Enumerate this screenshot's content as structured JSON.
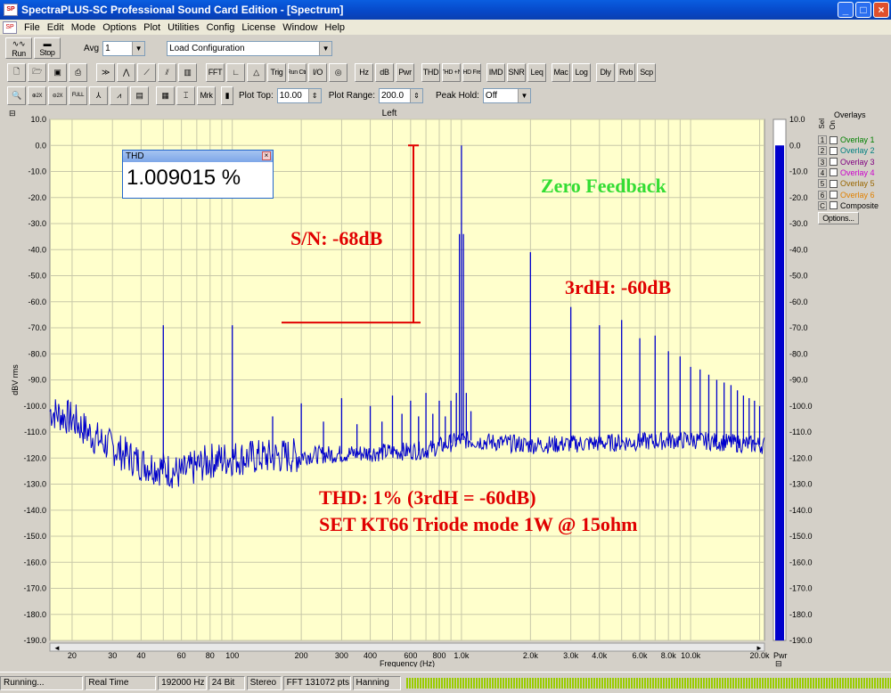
{
  "window": {
    "title": "SpectraPLUS-SC Professional Sound Card Edition - [Spectrum]",
    "buttons": [
      "_",
      "□",
      "×"
    ]
  },
  "menu": [
    "File",
    "Edit",
    "Mode",
    "Options",
    "Plot",
    "Utilities",
    "Config",
    "License",
    "Window",
    "Help"
  ],
  "toolbar1": {
    "run_label": "Run",
    "stop_label": "Stop",
    "avg_label": "Avg",
    "avg_value": "1",
    "config_value": "Load Configuration"
  },
  "toolbar2": [
    "FFT",
    "Trig",
    "Run Ctrl",
    "I/O",
    "Hz",
    "dB",
    "Pwr",
    "THD",
    "THD +N",
    "THD Freq",
    "IMD",
    "SNR",
    "Leq",
    "Mac",
    "Log",
    "Dly",
    "Rvb",
    "Scp"
  ],
  "toolbar3": {
    "plot_top_label": "Plot Top:",
    "plot_top_value": "10.00",
    "plot_range_label": "Plot Range:",
    "plot_range_value": "200.0",
    "peak_hold_label": "Peak Hold:",
    "peak_hold_value": "Off",
    "marker_label": "Mrk"
  },
  "plot": {
    "channel_title": "Left",
    "ylabel": "dBV rms",
    "xlabel": "Frequency (Hz)",
    "y_ticks": [
      "10.0",
      "0.0",
      "-10.0",
      "-20.0",
      "-30.0",
      "-40.0",
      "-50.0",
      "-60.0",
      "-70.0",
      "-80.0",
      "-90.0",
      "-100.0",
      "-110.0",
      "-120.0",
      "-130.0",
      "-140.0",
      "-150.0",
      "-160.0",
      "-170.0",
      "-180.0",
      "-190.0"
    ],
    "x_ticks": [
      "20",
      "30",
      "40",
      "60",
      "80",
      "100",
      "200",
      "300",
      "400",
      "600",
      "800",
      "1.0k",
      "2.0k",
      "3.0k",
      "4.0k",
      "6.0k",
      "8.0k",
      "10.0k",
      "20.0k"
    ],
    "line_color": "#0000cc",
    "background": "#ffffcc"
  },
  "chart_data": {
    "type": "line",
    "xscale": "log",
    "xlim": [
      16,
      21000
    ],
    "ylim": [
      -190,
      10
    ],
    "ylabel": "dBV rms",
    "xlabel": "Frequency (Hz)",
    "noise_floor": [
      [
        16,
        -102
      ],
      [
        20,
        -105
      ],
      [
        25,
        -112
      ],
      [
        30,
        -116
      ],
      [
        40,
        -122
      ],
      [
        50,
        -124
      ],
      [
        60,
        -126
      ],
      [
        80,
        -121
      ],
      [
        100,
        -120
      ],
      [
        200,
        -119
      ],
      [
        400,
        -118
      ],
      [
        700,
        -117
      ],
      [
        1000,
        -113
      ],
      [
        2000,
        -115
      ],
      [
        5000,
        -114
      ],
      [
        10000,
        -113
      ],
      [
        20000,
        -115
      ]
    ],
    "peaks": [
      {
        "f": 50,
        "db": -69
      },
      {
        "f": 100,
        "db": -69
      },
      {
        "f": 150,
        "db": -104
      },
      {
        "f": 200,
        "db": -99
      },
      {
        "f": 250,
        "db": -106
      },
      {
        "f": 300,
        "db": -97
      },
      {
        "f": 350,
        "db": -107
      },
      {
        "f": 400,
        "db": -100
      },
      {
        "f": 450,
        "db": -106
      },
      {
        "f": 500,
        "db": -96
      },
      {
        "f": 550,
        "db": -103
      },
      {
        "f": 600,
        "db": -98
      },
      {
        "f": 650,
        "db": -104
      },
      {
        "f": 700,
        "db": -95
      },
      {
        "f": 750,
        "db": -103
      },
      {
        "f": 800,
        "db": -98
      },
      {
        "f": 850,
        "db": -104
      },
      {
        "f": 900,
        "db": -98
      },
      {
        "f": 950,
        "db": -95
      },
      {
        "f": 1000,
        "db": 0
      },
      {
        "f": 1050,
        "db": -95
      },
      {
        "f": 1100,
        "db": -102
      },
      {
        "f": 2000,
        "db": -41
      },
      {
        "f": 3000,
        "db": -62
      },
      {
        "f": 4000,
        "db": -69
      },
      {
        "f": 5000,
        "db": -67
      },
      {
        "f": 6000,
        "db": -74
      },
      {
        "f": 7000,
        "db": -73
      },
      {
        "f": 8000,
        "db": -79
      },
      {
        "f": 9000,
        "db": -81
      },
      {
        "f": 10000,
        "db": -85
      },
      {
        "f": 11000,
        "db": -86
      },
      {
        "f": 12000,
        "db": -88
      },
      {
        "f": 13000,
        "db": -90
      },
      {
        "f": 14000,
        "db": -91
      },
      {
        "f": 15000,
        "db": -92
      },
      {
        "f": 16000,
        "db": -94
      },
      {
        "f": 17000,
        "db": -96
      },
      {
        "f": 18000,
        "db": -97
      },
      {
        "f": 19000,
        "db": -98
      },
      {
        "f": 20000,
        "db": -100
      }
    ],
    "sidebands_1k": [
      {
        "f": 980,
        "db": -34
      },
      {
        "f": 1020,
        "db": -34
      }
    ]
  },
  "thd_window": {
    "title": "THD",
    "value": "1.009015 %"
  },
  "annotations": {
    "zero_feedback": "Zero Feedback",
    "sn": "S/N: -68dB",
    "h3": "3rdH: -60dB",
    "thd_line1": "THD: 1% (3rdH = -60dB)",
    "thd_line2": "SET KT66 Triode mode 1W @ 15ohm"
  },
  "meter": {
    "ticks": [
      "10.0",
      "0.0",
      "-10.0",
      "-20.0",
      "-30.0",
      "-40.0",
      "-50.0",
      "-60.0",
      "-70.0",
      "-80.0",
      "-90.0",
      "-100.0",
      "-110.0",
      "-120.0",
      "-130.0",
      "-140.0",
      "-150.0",
      "-160.0",
      "-170.0",
      "-180.0",
      "-190.0"
    ],
    "label": "Pwr",
    "level_db": 0.0
  },
  "overlays": {
    "title": "Overlays",
    "col_sel": "Sel",
    "col_on": "On",
    "items": [
      {
        "num": "1",
        "label": "Overlay 1",
        "color": "#008000"
      },
      {
        "num": "2",
        "label": "Overlay 2",
        "color": "#008080"
      },
      {
        "num": "3",
        "label": "Overlay 3",
        "color": "#800080"
      },
      {
        "num": "4",
        "label": "Overlay 4",
        "color": "#cc00cc"
      },
      {
        "num": "5",
        "label": "Overlay 5",
        "color": "#996600"
      },
      {
        "num": "6",
        "label": "Overlay 6",
        "color": "#e08000"
      },
      {
        "num": "C",
        "label": "Composite",
        "color": "#000000"
      }
    ],
    "options_label": "Options..."
  },
  "status": {
    "state": "Running...",
    "mode": "Real Time",
    "rate": "192000 Hz",
    "bits": "24 Bit",
    "channels": "Stereo",
    "fft": "FFT 131072 pts",
    "window": "Hanning"
  }
}
